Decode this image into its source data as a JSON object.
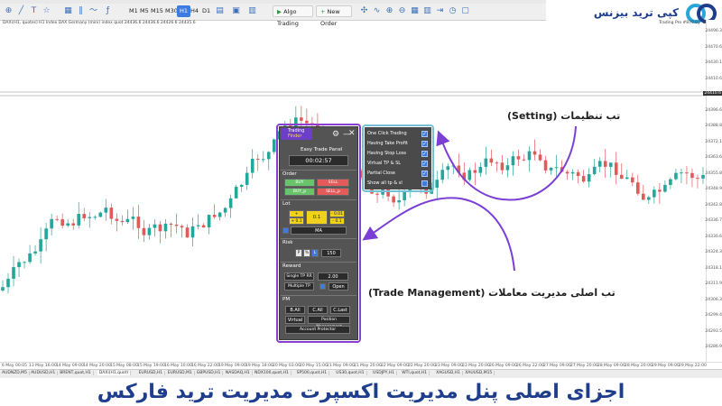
{
  "toolbar": {
    "timeframes": [
      "M1",
      "M5",
      "M15",
      "M30",
      "H1",
      "H4",
      "D1"
    ],
    "active_timeframe": "H1",
    "algo_trading_label": "Algo Trading",
    "new_order_label": "New Order"
  },
  "chart": {
    "symbol_line": "DAXi(H1, quotes) H1  Index DAX Germany (mini) index quot  24436.6 24436.6 24426.6 24435.6",
    "right_line": "Trading Pro #879 by 'ShiyA'",
    "price_labels": [
      "24496.3",
      "24470.6",
      "24430.1",
      "24410.6",
      "24404.1",
      "24396.6",
      "24388.8",
      "24372.1",
      "24363.6",
      "24355.8",
      "24348.9",
      "24342.8",
      "24336.7",
      "24330.6",
      "24324.3",
      "24318.1",
      "24311.9",
      "24306.3",
      "24299.4",
      "24293.5",
      "24286.9"
    ],
    "time_labels": [
      "6 May 00:05",
      "13 May 16:00",
      "14 May 09:00",
      "14 May 20:00",
      "15 May 08:00",
      "15 May 19:00",
      "16 May 10:00",
      "16 May 22:00",
      "19 May 09:00",
      "19 May 18:00",
      "20 May 03:00",
      "20 May 15:00",
      "21 May 09:00",
      "21 May 20:00",
      "22 May 09:00",
      "22 May 20:00",
      "23 May 09:00",
      "23 May 20:00",
      "26 May 09:00",
      "26 May 22:00",
      "27 May 09:00",
      "27 May 20:00",
      "28 May 09:00",
      "28 May 20:00",
      "29 May 09:00",
      "29 May 22:00"
    ],
    "tabs": [
      "AUDNZD,M5",
      "AUDUSD,H1",
      "BRENT,quot,H1",
      "DAXi(H1,quot)",
      "EURUSD,H1",
      "EURUSD,M1",
      "GBPUSD,H1",
      "NASDAQ,H1",
      "NDX100,quot,H1",
      "SP500,quot,H1",
      "US30,quot,H1",
      "USDJPY,H1",
      "WTI,quot,H1",
      "XAGUSD,H1",
      "XAUUSD,M15"
    ]
  },
  "panel": {
    "logo_line1": "Trading",
    "logo_line2": "Finder",
    "title": "Easy Trade Panel",
    "timer": "00:02:57",
    "order_label": "Order",
    "buy": "BUY",
    "sell": "SELL",
    "buy_p": "BUY_p",
    "sell_p": "SELL_p",
    "lot_label": "Lot",
    "lot_plus_001": "+ 0.01",
    "lot_plus_01": "+ 0.1",
    "lot_value": "0.1",
    "lot_minus_001": "- 0.01",
    "lot_minus_01": "- 0.1",
    "lot_mode": "MA",
    "risk_label": "Risk",
    "risk_p": "P",
    "risk_pct": "%",
    "risk_l": "L",
    "risk_value": "150",
    "reward_label": "Reward",
    "single_tp": "Single TP RR",
    "single_tp_value": "2.00",
    "multiple_tp": "Multiple TP",
    "open": "Open",
    "pm_label": "PM",
    "b_all": "B.All",
    "c_all": "C.All",
    "c_last": "C.Last",
    "virtual": "Virtual",
    "position_mgmt": "Position Management",
    "account_protector": "Account Protector"
  },
  "settings": {
    "items": [
      "One Click Trading",
      "Having Take Profit",
      "Having Stop Loss",
      "Virtual TP & SL",
      "Partial Close",
      "Show all tp & sl"
    ],
    "checked": [
      true,
      true,
      true,
      true,
      true,
      false
    ]
  },
  "annotations": {
    "setting_label": "تب تنظیمات (Setting)",
    "trade_mgmt_label": "تب اصلی مدیریت معاملات (Trade Management)"
  },
  "headline": "اجزای اصلی پنل مدیریت اکسپرت مدیریت ترید فارکس",
  "logo": {
    "text": "کپی ترید بیزنس"
  },
  "colors": {
    "bull": "#26a69a",
    "bear": "#e05a5a",
    "panel_frame": "#8a3fd1",
    "settings_frame": "#74c1d6",
    "headline": "#1e3d8c"
  }
}
